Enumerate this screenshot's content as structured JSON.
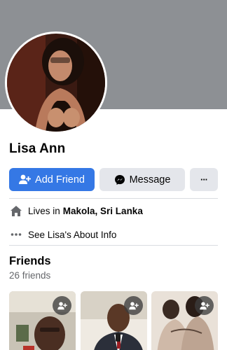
{
  "profile": {
    "name": "Lisa Ann",
    "avatar": "profile-photo"
  },
  "actions": {
    "add_friend": "Add Friend",
    "message": "Message",
    "more": "···"
  },
  "intro": {
    "lives_prefix": "Lives in",
    "location": "Makola, Sri Lanka",
    "about_link": "See Lisa's About Info"
  },
  "friends": {
    "title": "Friends",
    "count": "26 friends",
    "items": [
      {
        "icon": "add-friend-icon"
      },
      {
        "icon": "add-friend-icon"
      },
      {
        "icon": "add-friend-icon"
      }
    ]
  },
  "colors": {
    "accent": "#3578e5",
    "button_gray": "#e4e6eb",
    "cover": "#8d9094",
    "secondary_text": "#65676b"
  },
  "icons": {
    "add_friend": "add-person-icon",
    "message": "messenger-icon",
    "more": "more-dots-icon",
    "home": "home-icon",
    "about": "ellipsis-icon"
  }
}
